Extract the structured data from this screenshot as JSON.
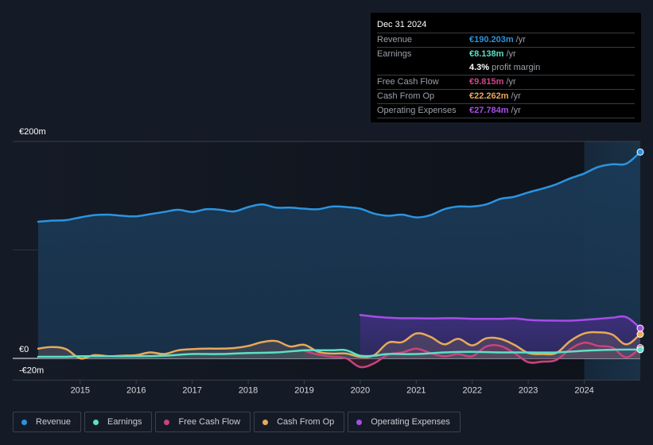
{
  "tooltip": {
    "date": "Dec 31 2024",
    "rows": [
      {
        "label": "Revenue",
        "value": "€190.203m",
        "unit": "/yr",
        "color": "#2b94e0"
      },
      {
        "label": "Earnings",
        "value": "€8.138m",
        "unit": "/yr",
        "color": "#5ce0c6"
      },
      {
        "label": "",
        "value": "4.3%",
        "unit": "profit margin",
        "color": "#ffffff"
      },
      {
        "label": "Free Cash Flow",
        "value": "€9.815m",
        "unit": "/yr",
        "color": "#d0458a"
      },
      {
        "label": "Cash From Op",
        "value": "€22.262m",
        "unit": "/yr",
        "color": "#e8a95a"
      },
      {
        "label": "Operating Expenses",
        "value": "€27.784m",
        "unit": "/yr",
        "color": "#a64ee6"
      }
    ]
  },
  "legend": [
    {
      "label": "Revenue",
      "color": "#2b94e0"
    },
    {
      "label": "Earnings",
      "color": "#5ce0c6"
    },
    {
      "label": "Free Cash Flow",
      "color": "#c8447f"
    },
    {
      "label": "Cash From Op",
      "color": "#e8a95a"
    },
    {
      "label": "Operating Expenses",
      "color": "#a64ee6"
    }
  ],
  "chart_data": {
    "type": "area",
    "title": "",
    "xlabel": "",
    "ylabel": "",
    "currency": "€",
    "y_tick_labels": [
      "€200m",
      "€0",
      "-€20m"
    ],
    "y_ticks": [
      200,
      0,
      -20
    ],
    "ylim": [
      -20,
      200
    ],
    "xlim": [
      2014.25,
      2025.0
    ],
    "x_tick_labels": [
      "2015",
      "2016",
      "2017",
      "2018",
      "2019",
      "2020",
      "2021",
      "2022",
      "2023",
      "2024"
    ],
    "x_ticks": [
      2015,
      2016,
      2017,
      2018,
      2019,
      2020,
      2021,
      2022,
      2023,
      2024
    ],
    "highlight_start": 2024.0,
    "grid": true,
    "legend_position": "bottom",
    "series": [
      {
        "name": "Revenue",
        "color": "#2b94e0",
        "x": [
          2014.25,
          2014.5,
          2014.75,
          2015.0,
          2015.25,
          2015.5,
          2015.75,
          2016.0,
          2016.25,
          2016.5,
          2016.75,
          2017.0,
          2017.25,
          2017.5,
          2017.75,
          2018.0,
          2018.25,
          2018.5,
          2018.75,
          2019.0,
          2019.25,
          2019.5,
          2019.75,
          2020.0,
          2020.25,
          2020.5,
          2020.75,
          2021.0,
          2021.25,
          2021.5,
          2021.75,
          2022.0,
          2022.25,
          2022.5,
          2022.75,
          2023.0,
          2023.25,
          2023.5,
          2023.75,
          2024.0,
          2024.25,
          2024.5,
          2024.75,
          2025.0
        ],
        "values": [
          126,
          127,
          127.5,
          130,
          132,
          132.5,
          131.5,
          131,
          133,
          135,
          137,
          135,
          137.5,
          137,
          135.5,
          139.5,
          142,
          139,
          139,
          138,
          137.5,
          140,
          139.5,
          138,
          133.5,
          131.5,
          132.5,
          130,
          132,
          137.5,
          140,
          140,
          142,
          147,
          149,
          153,
          156.5,
          160.5,
          166,
          170.5,
          176.5,
          179,
          179.5,
          190.2
        ]
      },
      {
        "name": "Operating Expenses",
        "color": "#a64ee6",
        "x": [
          2020.0,
          2020.25,
          2020.5,
          2020.75,
          2021.0,
          2021.25,
          2021.5,
          2021.75,
          2022.0,
          2022.25,
          2022.5,
          2022.75,
          2023.0,
          2023.25,
          2023.5,
          2023.75,
          2024.0,
          2024.25,
          2024.5,
          2024.75,
          2025.0
        ],
        "values": [
          40,
          38.5,
          37.5,
          37,
          37,
          36.8,
          37,
          37,
          36.5,
          36.5,
          36.5,
          36.8,
          35.5,
          35,
          34.8,
          34.8,
          35.5,
          36.5,
          37.5,
          38,
          27.8
        ]
      },
      {
        "name": "Cash From Op",
        "color": "#e8a95a",
        "x": [
          2014.25,
          2014.5,
          2014.75,
          2015.0,
          2015.25,
          2015.5,
          2015.75,
          2016.0,
          2016.25,
          2016.5,
          2016.75,
          2017.0,
          2017.25,
          2017.5,
          2017.75,
          2018.0,
          2018.25,
          2018.5,
          2018.75,
          2019.0,
          2019.25,
          2019.5,
          2019.75,
          2020.0,
          2020.25,
          2020.5,
          2020.75,
          2021.0,
          2021.25,
          2021.5,
          2021.75,
          2022.0,
          2022.25,
          2022.5,
          2022.75,
          2023.0,
          2023.25,
          2023.5,
          2023.75,
          2024.0,
          2024.25,
          2024.5,
          2024.75,
          2025.0
        ],
        "values": [
          9,
          10.5,
          8.5,
          0,
          3,
          2,
          2.5,
          3,
          5.5,
          4,
          7.5,
          8.5,
          9,
          9,
          9.5,
          11.5,
          15,
          16,
          11,
          12.5,
          6,
          4.5,
          4.5,
          1.5,
          3,
          14.5,
          15,
          23,
          20,
          13,
          18,
          12,
          18.5,
          18,
          12.5,
          5,
          4,
          5,
          16,
          23,
          24,
          22,
          13,
          22.3
        ]
      },
      {
        "name": "Free Cash Flow",
        "color": "#c8447f",
        "x": [
          2019.0,
          2019.25,
          2019.5,
          2019.75,
          2020.0,
          2020.25,
          2020.5,
          2020.75,
          2021.0,
          2021.25,
          2021.5,
          2021.75,
          2022.0,
          2022.25,
          2022.5,
          2022.75,
          2023.0,
          2023.25,
          2023.5,
          2023.75,
          2024.0,
          2024.25,
          2024.5,
          2024.75,
          2025.0
        ],
        "values": [
          7,
          3.5,
          1.5,
          0,
          -8,
          -4.5,
          3.5,
          5.5,
          9,
          5,
          2,
          4,
          2,
          11,
          11.5,
          5,
          -3.5,
          -3,
          -1.5,
          8.5,
          14.5,
          11.5,
          10,
          1,
          9.8
        ]
      },
      {
        "name": "Earnings",
        "color": "#5ce0c6",
        "x": [
          2014.25,
          2014.5,
          2014.75,
          2015.0,
          2015.5,
          2016.0,
          2016.5,
          2017.0,
          2017.5,
          2018.0,
          2018.5,
          2019.0,
          2019.25,
          2019.5,
          2019.75,
          2020.0,
          2020.25,
          2020.5,
          2021.0,
          2021.5,
          2022.0,
          2022.5,
          2023.0,
          2023.5,
          2024.0,
          2024.5,
          2025.0
        ],
        "values": [
          1.5,
          1.5,
          1.5,
          2,
          2,
          2,
          2.5,
          4,
          4,
          5,
          5.5,
          7.5,
          7.5,
          7.5,
          7.5,
          2.5,
          2.5,
          4,
          4,
          5.5,
          6,
          5.5,
          5.5,
          5.5,
          7,
          8,
          8.1
        ]
      }
    ]
  }
}
